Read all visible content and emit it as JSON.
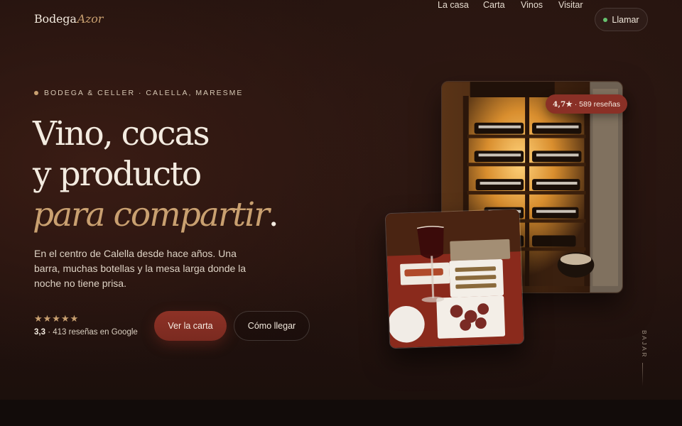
{
  "brand": {
    "name": "Bodega",
    "accent": "Azor"
  },
  "nav": {
    "links": [
      "La casa",
      "Carta",
      "Vinos",
      "Visitar"
    ],
    "cta": "Llamar"
  },
  "hero": {
    "eyebrow": "BODEGA & CELLER · CALELLA, MARESME",
    "headline": {
      "line1": "Vino, cocas",
      "line2": "y producto",
      "line3": "para compartir",
      "period": "."
    },
    "lede": "En el centro de Calella desde hace años. Una barra, muchas botellas y la mesa larga donde la noche no tiene prisa.",
    "rating": {
      "stars": "★★★★★",
      "score": "3,3",
      "text": "· 413 reseñas en Google"
    },
    "buttons": {
      "primary": "Ver la carta",
      "secondary": "Cómo llegar"
    }
  },
  "badge": {
    "score": "4,7★",
    "text": "· 589 reseñas"
  },
  "scroll_hint": "BAJAR",
  "colors": {
    "background": "#24130f",
    "accent_gold": "#c9a070",
    "brand_red": "#8a3026",
    "status_green": "#67c26f"
  },
  "icons": [
    "status-dot-icon",
    "star-icon"
  ]
}
